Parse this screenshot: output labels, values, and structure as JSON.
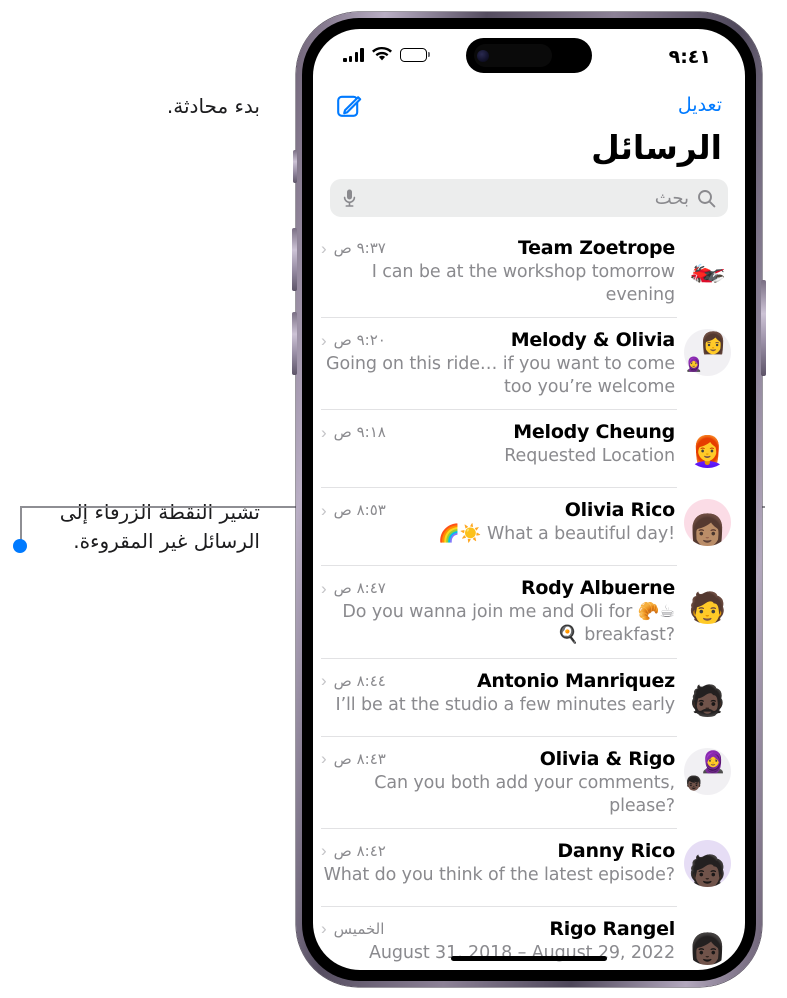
{
  "callouts": {
    "compose": "بدء محادثة.",
    "unread": "تشير النقطة الزرقاء إلى\nالرسائل غير المقروءة."
  },
  "status_bar": {
    "time": "٩:٤١",
    "battery_icon": "battery-icon",
    "wifi_icon": "wifi-icon",
    "cellular_icon": "cellular-signal-icon"
  },
  "nav": {
    "edit_label": "تعديل",
    "compose_icon": "compose-icon",
    "title": "الرسائل"
  },
  "search": {
    "placeholder": "بحث",
    "search_icon": "search-icon",
    "mic_icon": "microphone-icon"
  },
  "colors": {
    "accent": "#007aff",
    "unread_dot": "#007aff",
    "search_bg": "#eceded",
    "secondary_text": "#8a8a8e"
  },
  "conversations": [
    {
      "name": "Team Zoetrope",
      "time": "٩:٣٧ ص",
      "preview": "I can be at the workshop tomorrow evening",
      "unread": false,
      "avatar_kind": "photo",
      "avatar_label": "team-zoetrope-avatar",
      "emoji": "🏍️"
    },
    {
      "name": "Melody & Olivia",
      "time": "٩:٢٠ ص",
      "preview": "Going on this ride… if you want to come too you’re welcome",
      "unread": false,
      "avatar_kind": "group",
      "avatar_label": "melody-olivia-avatar",
      "emoji": "👩",
      "emoji2": "🧕"
    },
    {
      "name": "Melody Cheung",
      "time": "٩:١٨ ص",
      "preview": "Requested Location",
      "unread": false,
      "avatar_kind": "memoji",
      "avatar_label": "melody-cheung-avatar",
      "emoji": "👩‍🦰"
    },
    {
      "name": "Olivia Rico",
      "time": "٨:٥٣ ص",
      "preview": "🌈☀️ What a beautiful day!",
      "unread": true,
      "avatar_kind": "memoji",
      "avatar_label": "olivia-rico-avatar",
      "emoji": "👩🏽"
    },
    {
      "name": "Rody Albuerne",
      "time": "٨:٤٧ ص",
      "preview": "Do you wanna join me and Oli for 🥐☕ 🍳 breakfast?",
      "unread": false,
      "avatar_kind": "memoji",
      "avatar_label": "rody-albuerne-avatar",
      "emoji": "🧑"
    },
    {
      "name": "Antonio Manriquez",
      "time": "٨:٤٤ ص",
      "preview": "I’ll be at the studio a few minutes early",
      "unread": false,
      "avatar_kind": "memoji",
      "avatar_label": "antonio-manriquez-avatar",
      "emoji": "🧔🏿"
    },
    {
      "name": "Olivia & Rigo",
      "time": "٨:٤٣ ص",
      "preview": "Can you both add your comments, please?",
      "unread": false,
      "avatar_kind": "group",
      "avatar_label": "olivia-rigo-avatar",
      "emoji": "🧕",
      "emoji2": "👦🏿"
    },
    {
      "name": "Danny Rico",
      "time": "٨:٤٢ ص",
      "preview": "What do you think of the latest episode?",
      "unread": false,
      "avatar_kind": "memoji",
      "avatar_label": "danny-rico-avatar",
      "emoji": "🧑🏿"
    },
    {
      "name": "Rigo Rangel",
      "time": "الخميس",
      "preview": "August 31, 2018 – August 29, 2022",
      "unread": false,
      "avatar_kind": "memoji",
      "avatar_label": "rigo-rangel-avatar",
      "emoji": "👩🏿"
    }
  ]
}
